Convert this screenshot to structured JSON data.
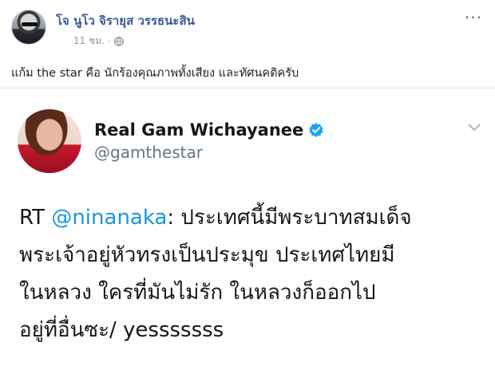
{
  "post": {
    "author_name": "โจ นูโว จิรายุส วรรธนะสิน",
    "timestamp": "11 ชม.",
    "meta_separator": "·",
    "privacy_icon": "globe-icon",
    "more_icon": "more-icon",
    "text": "แก้ม the star คือ นักร้องคุณภาพทั้งเสียง และทัศนคติครับ"
  },
  "tweet": {
    "display_name": "Real Gam Wichayanee",
    "handle": "@gamthestar",
    "verified": true,
    "colors": {
      "verified": "#1da1f2",
      "mention": "#1b95e0",
      "handle": "#657786"
    },
    "body": {
      "prefix": "RT ",
      "mention": "@ninanaka",
      "line1_rest": ": ประเทศนี้มีพระบาทสมเด็จ",
      "line2": "พระเจ้าอยู่หัวทรงเป็นประมุข ประเทศไทยมี",
      "line3": "ในหลวง ใครที่มันไม่รัก ในหลวงก็ออกไป",
      "line4": "อยู่ที่อื่นซะ/ yesssssss"
    }
  },
  "colors": {
    "author_link": "#385898",
    "meta": "#90949c"
  }
}
